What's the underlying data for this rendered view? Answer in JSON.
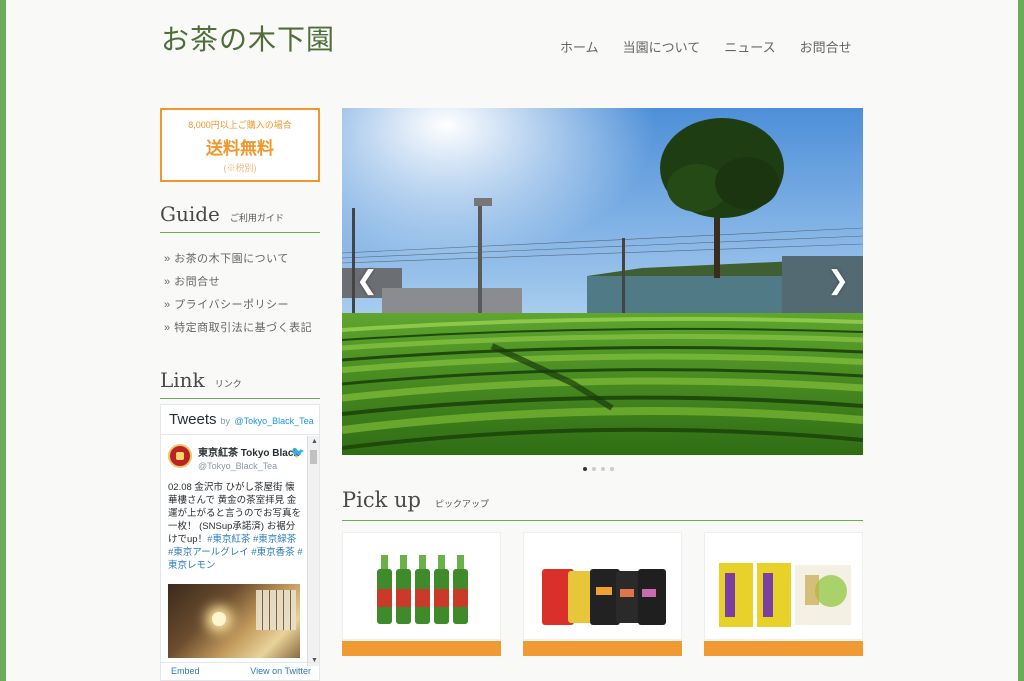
{
  "site": {
    "title": "お茶の木下園"
  },
  "nav": [
    "ホーム",
    "当園について",
    "ニュース",
    "お問合せ"
  ],
  "promo": {
    "condition": "8,000円以上ご購入の場合",
    "headline": "送料無料",
    "tax_note": "(※税別)"
  },
  "guide": {
    "title_en": "Guide",
    "title_jp": "ご利用ガイド",
    "items": [
      "» お茶の木下園について",
      "» お問合せ",
      "» プライバシーポリシー",
      "» 特定商取引法に基づく表記"
    ]
  },
  "link": {
    "title_en": "Link",
    "title_jp": "リンク"
  },
  "twitter": {
    "header": "Tweets",
    "by": "by",
    "handle_link": "@Tokyo_Black_Tea",
    "user_name": "東京紅茶 Tokyo Black",
    "user_handle": "@Tokyo_Black_Tea",
    "tweet_plain": "02.08 金沢市 ひがし茶屋街 懐華樓さんで 黄金の茶室拝見 金運が上がると言うのでお写真を一枚！ (SNSup承諾済) お裾分けでup！",
    "tags": "#東京紅茶 #東京緑茶 #東京アールグレイ #東京香茶 #東京レモン",
    "embed": "Embed",
    "view": "View on Twitter"
  },
  "slider": {
    "prev": "❮",
    "next": "❯",
    "slide_count": 4,
    "active_index": 0
  },
  "pickup": {
    "title_en": "Pick up",
    "title_jp": "ピックアップ"
  },
  "colors": {
    "accent_green": "#6bab5a",
    "accent_orange": "#f09a34",
    "title_green": "#4f6e3a"
  }
}
